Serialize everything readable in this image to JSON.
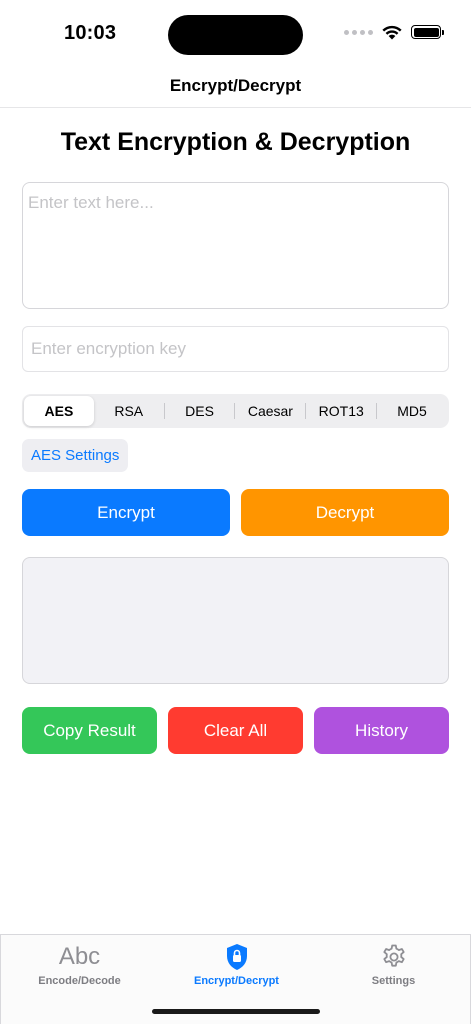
{
  "status": {
    "time": "10:03"
  },
  "nav": {
    "title": "Encrypt/Decrypt"
  },
  "main": {
    "title": "Text Encryption & Decryption",
    "text_input": {
      "placeholder": "Enter text here...",
      "value": ""
    },
    "key_input": {
      "placeholder": "Enter encryption key",
      "value": ""
    },
    "algorithms": [
      {
        "label": "AES",
        "selected": true
      },
      {
        "label": "RSA",
        "selected": false
      },
      {
        "label": "DES",
        "selected": false
      },
      {
        "label": "Caesar",
        "selected": false
      },
      {
        "label": "ROT13",
        "selected": false
      },
      {
        "label": "MD5",
        "selected": false
      }
    ],
    "settings_label": "AES Settings",
    "encrypt_label": "Encrypt",
    "decrypt_label": "Decrypt",
    "result": "",
    "copy_label": "Copy Result",
    "clear_label": "Clear All",
    "history_label": "History"
  },
  "tabs": [
    {
      "label": "Encode/Decode",
      "icon": "abc-icon",
      "glyph": "Abc",
      "active": false
    },
    {
      "label": "Encrypt/Decrypt",
      "icon": "lock-shield-icon",
      "active": true
    },
    {
      "label": "Settings",
      "icon": "gear-icon",
      "active": false
    }
  ],
  "colors": {
    "accent": "#0a7aff",
    "encrypt": "#0a7aff",
    "decrypt": "#ff9500",
    "copy": "#34c759",
    "clear": "#ff3b30",
    "history": "#af52de"
  }
}
